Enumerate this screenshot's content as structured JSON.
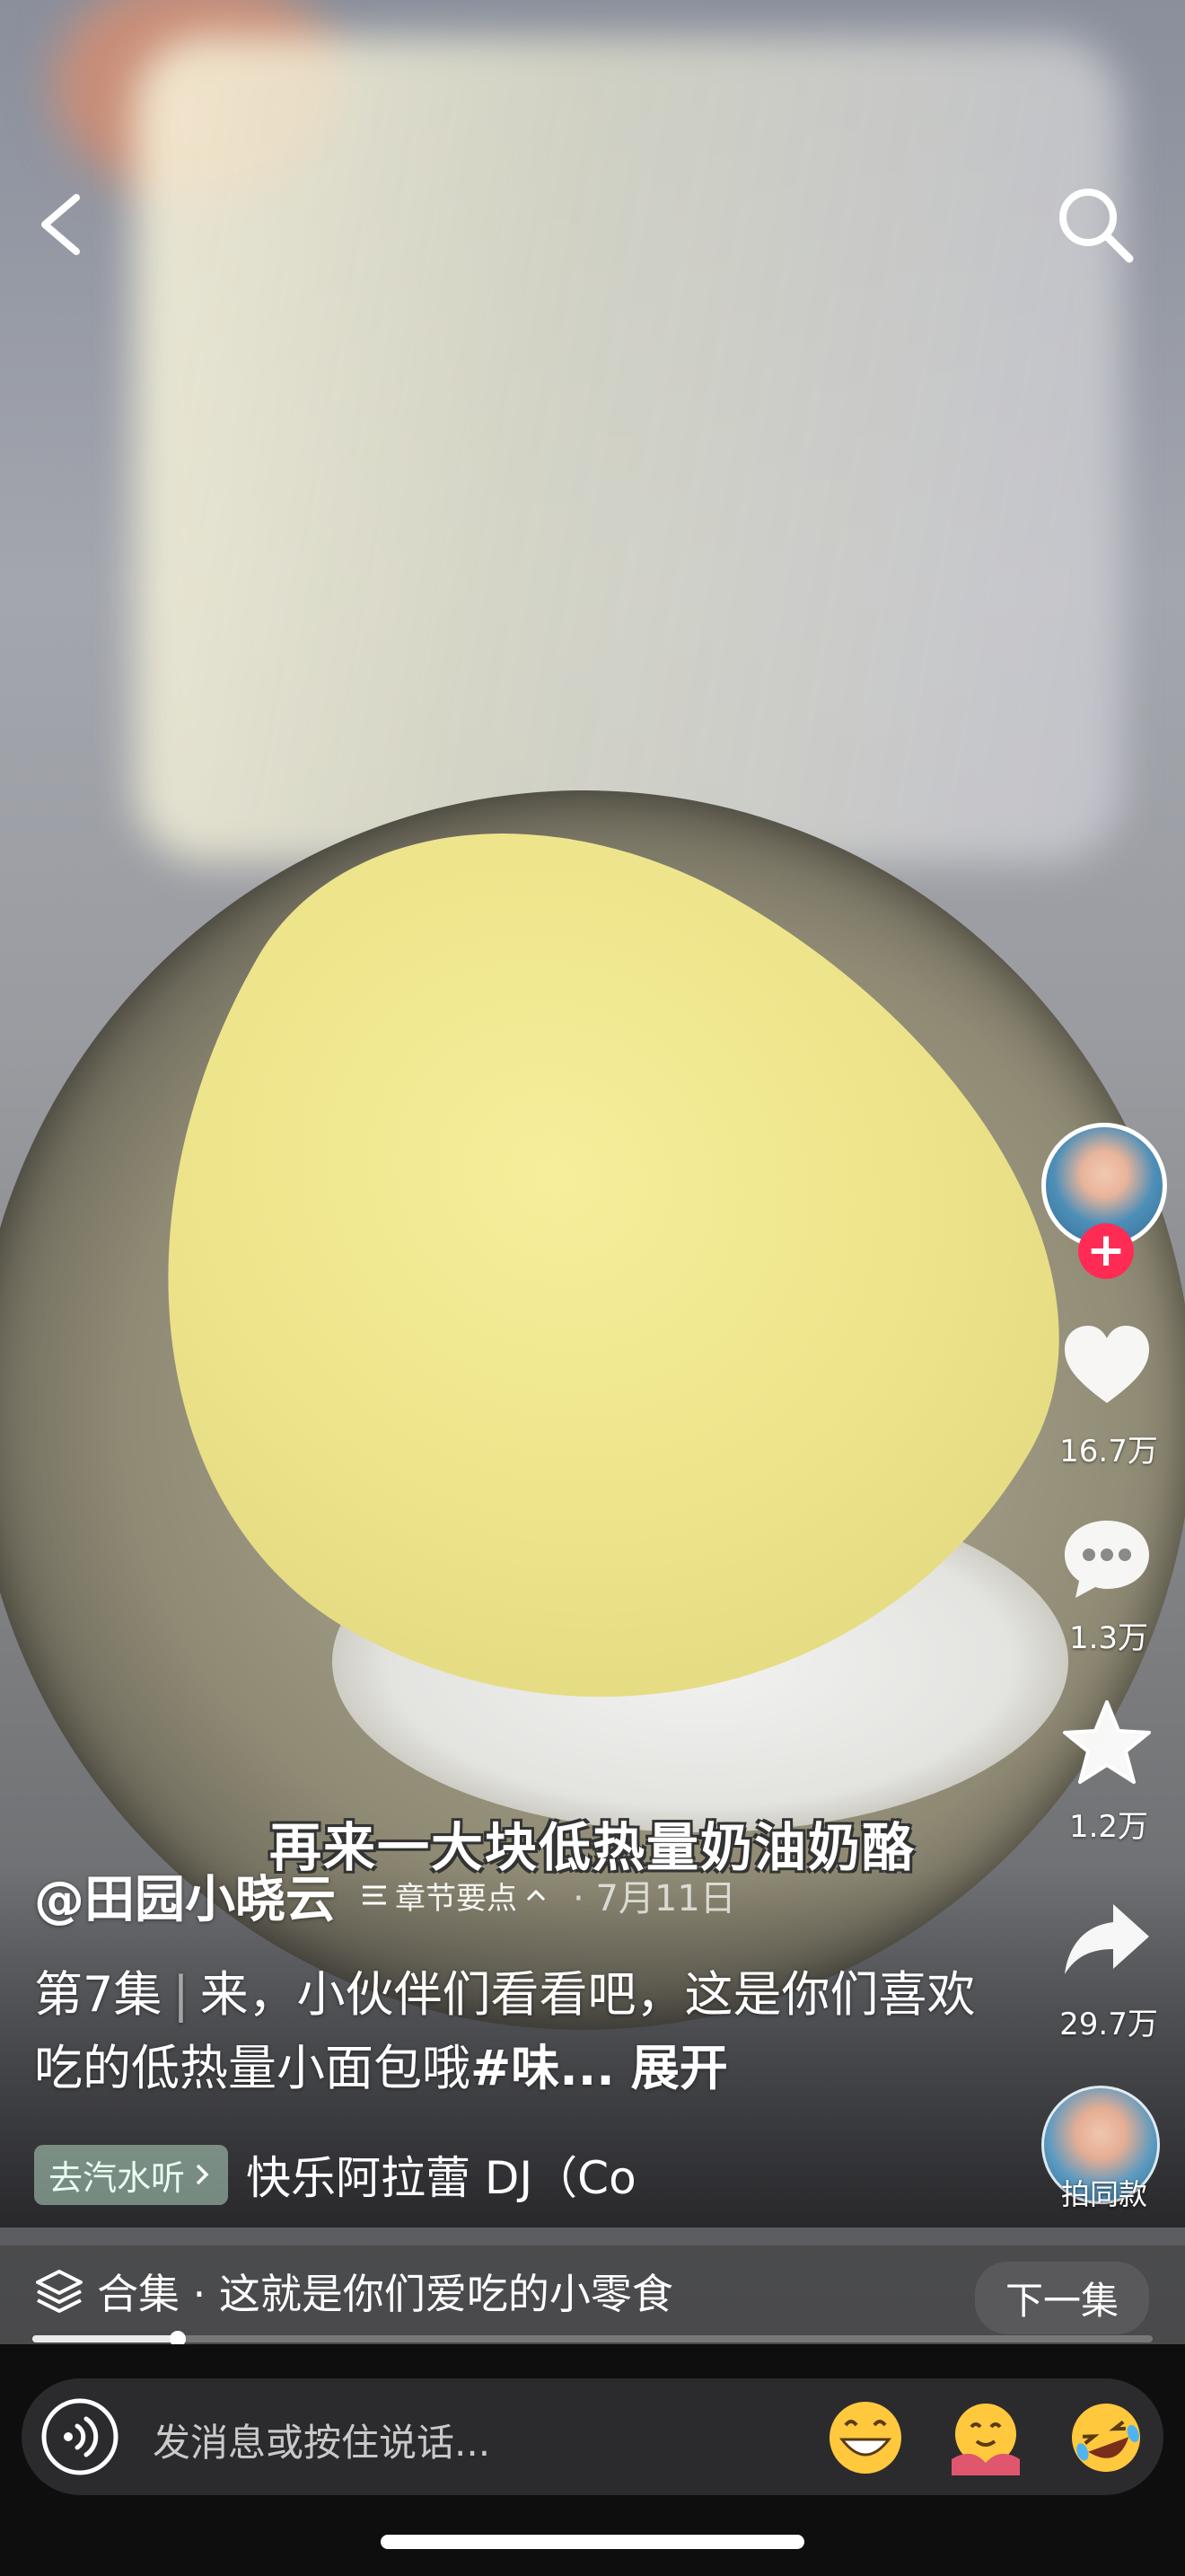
{
  "video": {
    "subtitle": "再来一大块低热量奶油奶酪"
  },
  "header": {
    "back_icon": "chevron-left-icon",
    "search_icon": "search-icon"
  },
  "sidebar": {
    "like_count": "16.7万",
    "comment_count": "1.3万",
    "favorite_count": "1.2万",
    "share_count": "29.7万",
    "same_style_label": "拍同款",
    "follow_symbol": "+"
  },
  "post": {
    "author": "@田园小晓云",
    "chapter_label": "章节要点",
    "date": "7月11日",
    "episode": "第7集",
    "description": "来，小伙伴们看看吧，这是你们喜欢吃的低热量小面包哦",
    "hashtag": "#味...",
    "expand_label": "展开"
  },
  "music": {
    "chip_label": "去汽水听",
    "title": "快乐阿拉蕾 DJ（Co"
  },
  "collection": {
    "label": "合集 · 这就是你们爱吃的小零食",
    "next_label": "下一集",
    "progress_fraction": 0.13
  },
  "message": {
    "placeholder": "发消息或按住说话..."
  },
  "colors": {
    "accent_red": "#fe2c55",
    "favorite_star": "#ffffff",
    "chip_bg": "#b4d7c3"
  }
}
